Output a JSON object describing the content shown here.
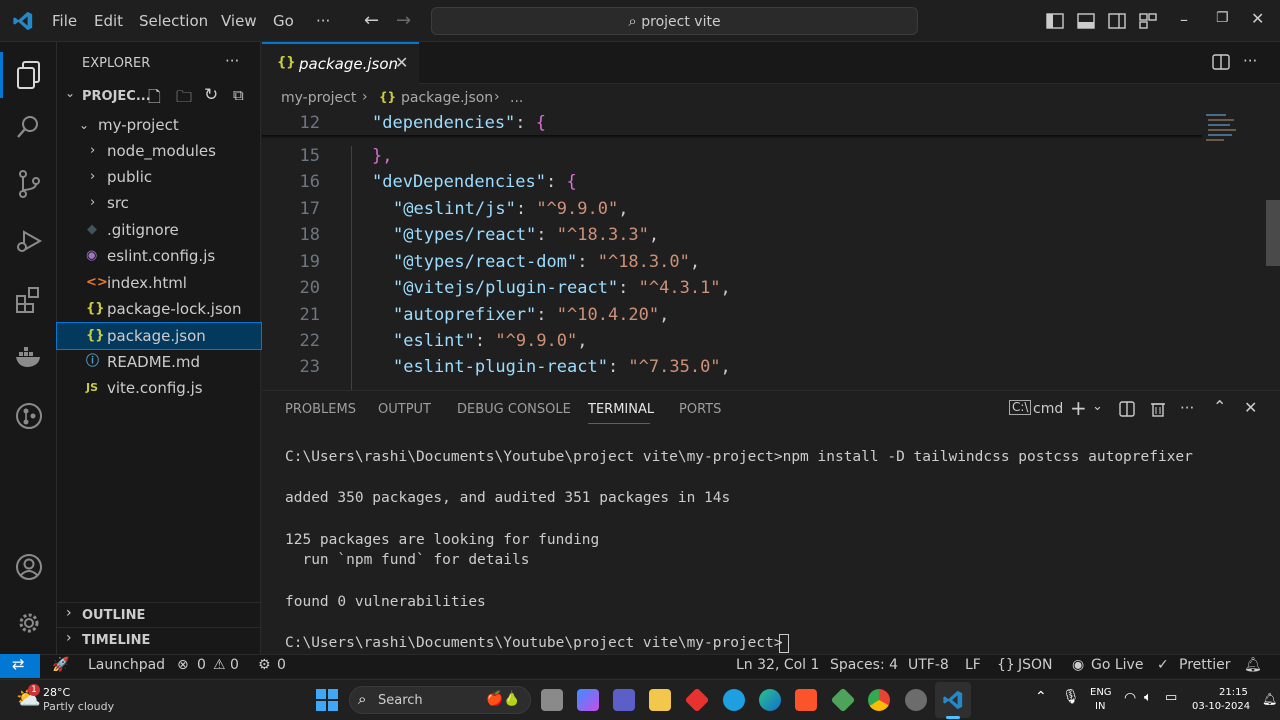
{
  "menu": {
    "file": "File",
    "edit": "Edit",
    "selection": "Selection",
    "view": "View",
    "go": "Go",
    "more": "···"
  },
  "command_center": "project vite",
  "explorer": {
    "title": "EXPLORER",
    "project": "PROJEC...",
    "items": [
      {
        "label": "my-project"
      },
      {
        "label": "node_modules"
      },
      {
        "label": "public"
      },
      {
        "label": "src"
      },
      {
        "label": ".gitignore"
      },
      {
        "label": "eslint.config.js"
      },
      {
        "label": "index.html"
      },
      {
        "label": "package-lock.json"
      },
      {
        "label": "package.json"
      },
      {
        "label": "README.md"
      },
      {
        "label": "vite.config.js"
      }
    ],
    "outline": "OUTLINE",
    "timeline": "TIMELINE"
  },
  "tab": {
    "label": "package.json",
    "icon": "{}"
  },
  "breadcrumb": {
    "root": "my-project",
    "file": "package.json",
    "more": "..."
  },
  "editor": {
    "lines": [
      {
        "num": "12",
        "key": "\"dependencies\"",
        "rest": ": ",
        "brace": "{",
        "val": "",
        "end": ""
      },
      {
        "num": "15",
        "key": "",
        "rest": "",
        "brace": "},",
        "val": "",
        "end": ""
      },
      {
        "num": "16",
        "key": "\"devDependencies\"",
        "rest": ": ",
        "brace": "{",
        "val": "",
        "end": ""
      },
      {
        "num": "17",
        "key": "\"@eslint/js\"",
        "rest": ": ",
        "brace": "",
        "val": "\"^9.9.0\"",
        "end": ","
      },
      {
        "num": "18",
        "key": "\"@types/react\"",
        "rest": ": ",
        "brace": "",
        "val": "\"^18.3.3\"",
        "end": ","
      },
      {
        "num": "19",
        "key": "\"@types/react-dom\"",
        "rest": ": ",
        "brace": "",
        "val": "\"^18.3.0\"",
        "end": ","
      },
      {
        "num": "20",
        "key": "\"@vitejs/plugin-react\"",
        "rest": ": ",
        "brace": "",
        "val": "\"^4.3.1\"",
        "end": ","
      },
      {
        "num": "21",
        "key": "\"autoprefixer\"",
        "rest": ": ",
        "brace": "",
        "val": "\"^10.4.20\"",
        "end": ","
      },
      {
        "num": "22",
        "key": "\"eslint\"",
        "rest": ": ",
        "brace": "",
        "val": "\"^9.9.0\"",
        "end": ","
      },
      {
        "num": "23",
        "key": "\"eslint-plugin-react\"",
        "rest": ": ",
        "brace": "",
        "val": "\"^7.35.0\"",
        "end": ","
      }
    ]
  },
  "panel": {
    "tabs": [
      "PROBLEMS",
      "OUTPUT",
      "DEBUG CONSOLE",
      "TERMINAL",
      "PORTS"
    ],
    "shell": "cmd",
    "terminal": [
      "C:\\Users\\rashi\\Documents\\Youtube\\project vite\\my-project>npm install -D tailwindcss postcss autoprefixer",
      "added 350 packages, and audited 351 packages in 14s",
      "125 packages are looking for funding",
      "  run `npm fund` for details",
      "found 0 vulnerabilities",
      "C:\\Users\\rashi\\Documents\\Youtube\\project vite\\my-project>"
    ]
  },
  "status": {
    "launchpad": "Launchpad",
    "errors": "0",
    "warnings": "0",
    "ports": "0",
    "position": "Ln 32, Col 1",
    "spaces": "Spaces: 4",
    "encoding": "UTF-8",
    "eol": "LF",
    "language": "JSON",
    "golive": "Go Live",
    "prettier": "Prettier"
  },
  "taskbar": {
    "temp": "28°C",
    "weather": "Partly cloudy",
    "search": "Search",
    "lang1": "ENG",
    "lang2": "IN",
    "time": "21:15",
    "date": "03-10-2024",
    "badge": "1"
  },
  "colors": {
    "accent": "#0078d4",
    "bg": "#1f1f1f",
    "sidebar": "#181818"
  }
}
